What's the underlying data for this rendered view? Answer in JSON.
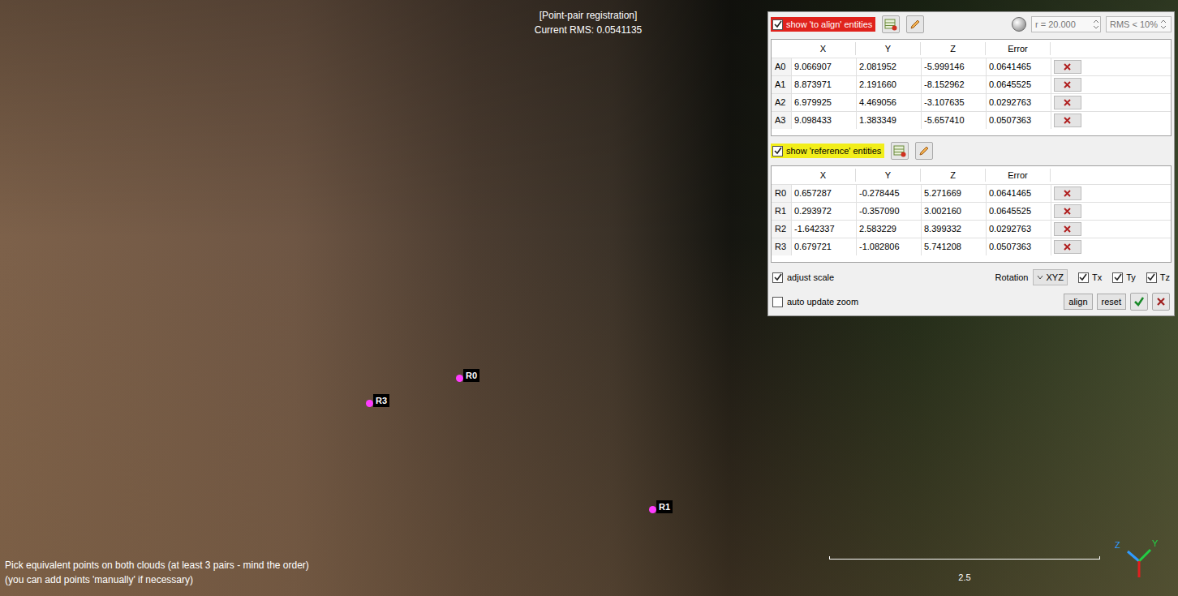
{
  "window": {
    "title": "[Point-pair registration]",
    "rms": "Current RMS: 0.0541135"
  },
  "hint_lines": [
    "Pick equivalent points on both clouds (at least 3 pairs - mind the order)",
    "(you can add points 'manually' if necessary)"
  ],
  "scale_label": "2.5",
  "markers": [
    {
      "label": "R0"
    },
    {
      "label": "R3"
    },
    {
      "label": "R1"
    }
  ],
  "axes": [
    {
      "label": "Z",
      "color": "#2f9bff"
    },
    {
      "label": "Y",
      "color": "#22cc44"
    }
  ],
  "panel": {
    "to_align": {
      "label": "show 'to align' entities",
      "checked": true,
      "color": "#e0221c",
      "columns": [
        "X",
        "Y",
        "Z",
        "Error"
      ],
      "rows": [
        {
          "name": "A0",
          "x": "9.066907",
          "y": "2.081952",
          "z": "-5.999146",
          "error": "0.0641465"
        },
        {
          "name": "A1",
          "x": "8.873971",
          "y": "2.191660",
          "z": "-8.152962",
          "error": "0.0645525"
        },
        {
          "name": "A2",
          "x": "6.979925",
          "y": "4.469056",
          "z": "-3.107635",
          "error": "0.0292763"
        },
        {
          "name": "A3",
          "x": "9.098433",
          "y": "1.383349",
          "z": "-5.657410",
          "error": "0.0507363"
        }
      ]
    },
    "reference": {
      "label": "show 'reference' entities",
      "checked": true,
      "color": "#f2ee1a",
      "columns": [
        "X",
        "Y",
        "Z",
        "Error"
      ],
      "rows": [
        {
          "name": "R0",
          "x": "0.657287",
          "y": "-0.278445",
          "z": "5.271669",
          "error": "0.0641465"
        },
        {
          "name": "R1",
          "x": "0.293972",
          "y": "-0.357090",
          "z": "3.002160",
          "error": "0.0645525"
        },
        {
          "name": "R2",
          "x": "-1.642337",
          "y": "2.583229",
          "z": "8.399332",
          "error": "0.0292763"
        },
        {
          "name": "R3",
          "x": "0.679721",
          "y": "-1.082806",
          "z": "5.741208",
          "error": "0.0507363"
        }
      ]
    },
    "radius": "r = 20.000",
    "rms_filter": "RMS < 10%",
    "adjust_scale": {
      "label": "adjust scale",
      "checked": true
    },
    "rotation": {
      "label": "Rotation",
      "value": "XYZ"
    },
    "translations": [
      {
        "label": "Tx",
        "checked": true
      },
      {
        "label": "Ty",
        "checked": true
      },
      {
        "label": "Tz",
        "checked": true
      }
    ],
    "auto_update_zoom": {
      "label": "auto update zoom",
      "checked": false
    },
    "buttons": [
      "align",
      "reset"
    ]
  }
}
